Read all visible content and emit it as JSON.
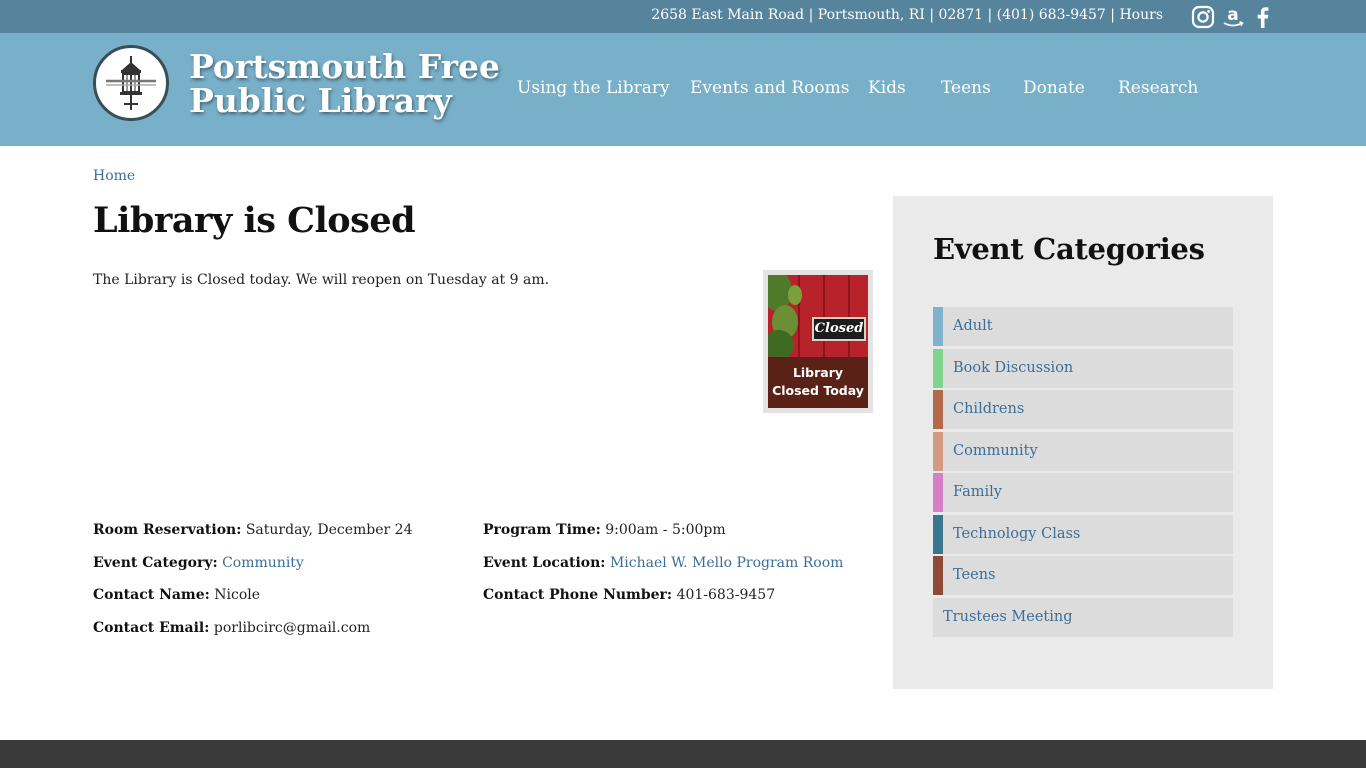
{
  "topbar": {
    "address": "2658 East Main Road",
    "city": "Portsmouth, RI",
    "zip": "02871",
    "phone": "(401) 683-9457",
    "hours_link": "Hours",
    "separator": "|",
    "social": [
      "instagram-icon",
      "amazon-icon",
      "facebook-icon"
    ]
  },
  "header": {
    "logo_line1": "Portsmouth Free",
    "logo_line2": "Public Library",
    "nav": [
      "Using the Library",
      "Events and Rooms",
      "Kids",
      "Teens",
      "Donate",
      "Research"
    ]
  },
  "breadcrumb": {
    "home": "Home"
  },
  "event": {
    "title": "Library is Closed",
    "description": "The Library is Closed today.  We will reopen on Tuesday at 9 am.",
    "image": {
      "sign_text": "Closed",
      "caption_line1": "Library",
      "caption_line2": "Closed Today"
    },
    "room_reservation_label": "Room Reservation:",
    "room_reservation_value": "Saturday, December 24",
    "program_time_label": "Program Time:",
    "program_time_value": "9:00am - 5:00pm",
    "category_label": "Event Category:",
    "category_value": "Community",
    "location_label": "Event Location:",
    "location_value": "Michael W. Mello Program Room",
    "contact_name_label": "Contact Name:",
    "contact_name_value": "Nicole",
    "contact_phone_label": "Contact Phone Number:",
    "contact_phone_value": "401-683-9457",
    "contact_email_label": "Contact Email:",
    "contact_email_value": "porlibcirc@gmail.com"
  },
  "sidebar": {
    "title": "Event Categories",
    "categories": [
      {
        "label": "Adult",
        "color": "#7fb2cb"
      },
      {
        "label": "Book Discussion",
        "color": "#7fd48e"
      },
      {
        "label": "Childrens",
        "color": "#b36a4b"
      },
      {
        "label": "Community",
        "color": "#d49a82"
      },
      {
        "label": "Family",
        "color": "#d57fc7"
      },
      {
        "label": "Technology Class",
        "color": "#3a7590"
      },
      {
        "label": "Teens",
        "color": "#8d4a35"
      },
      {
        "label": "Trustees Meeting",
        "color": ""
      }
    ]
  },
  "colors": {
    "topbar": "#55849c",
    "header": "#78b0c9",
    "link": "#3b6e98",
    "sidebar_bg": "#eaeaea",
    "footer": "#3a3a3a"
  }
}
